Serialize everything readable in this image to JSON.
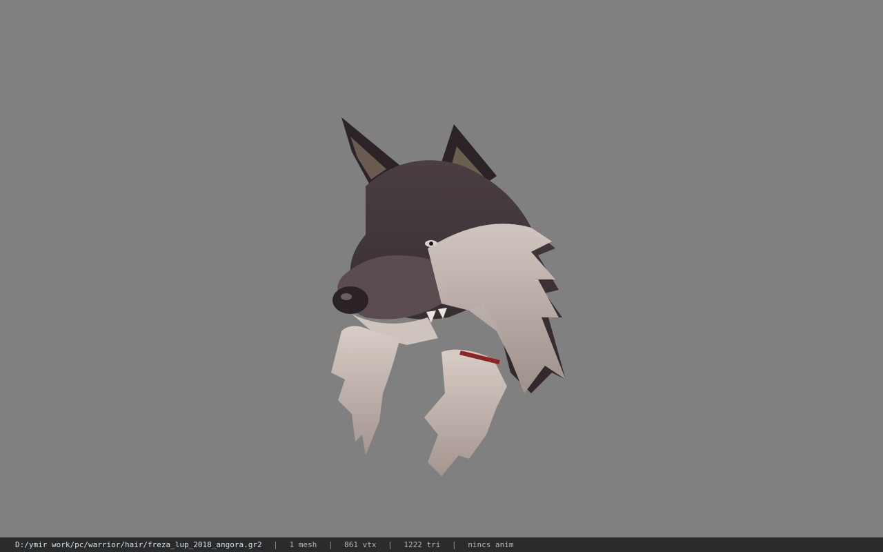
{
  "viewer": {
    "background_color": "#808080",
    "model_name": "wolf head hair model"
  },
  "statusbar": {
    "path": "D:/ymir work/pc/warrior/hair/freza_lup_2018_angora.gr2",
    "separator": "|",
    "mesh": "1 mesh",
    "vertices": "861 vtx",
    "triangles": "1222 tri",
    "anim": "nincs anim"
  }
}
